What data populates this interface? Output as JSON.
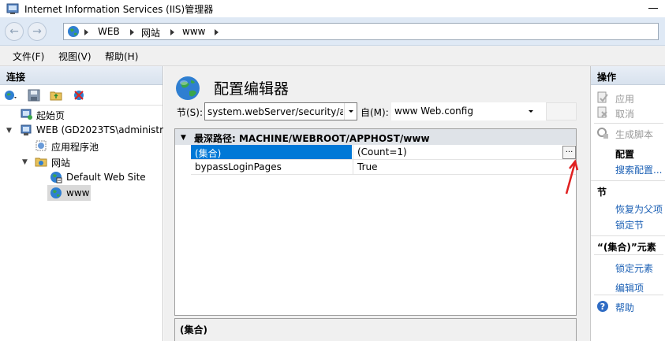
{
  "window": {
    "title": "Internet Information Services (IIS)管理器"
  },
  "address": {
    "crumbs": [
      "WEB",
      "网站",
      "www"
    ]
  },
  "menu": [
    "文件(F)",
    "视图(V)",
    "帮助(H)"
  ],
  "connections": {
    "header": "连接",
    "tree": [
      {
        "label": "起始页"
      },
      {
        "label": "WEB (GD2023TS\\administr"
      },
      {
        "label": "应用程序池"
      },
      {
        "label": "网站"
      },
      {
        "label": "Default Web Site"
      },
      {
        "label": "www"
      }
    ]
  },
  "editor": {
    "title": "配置编辑器",
    "section_label": "节(S):",
    "section_value": "system.webServer/security/au",
    "from_label": "自(M):",
    "from_value": "www Web.config",
    "group_header": "最深路径: MACHINE/WEBROOT/APPHOST/www",
    "rows": [
      {
        "key": "(集合)",
        "value": "(Count=1)"
      },
      {
        "key": "bypassLoginPages",
        "value": "True"
      }
    ],
    "ellipsis": "...",
    "details_label": "(集合)"
  },
  "actions": {
    "header": "操作",
    "apply": "应用",
    "cancel": "取消",
    "generate_script": "生成脚本",
    "config_title": "配置",
    "search_config": "搜索配置...",
    "section_header": "节",
    "restore_parent": "恢复为父项",
    "lock_section": "锁定节",
    "element_header": "“(集合)”元素",
    "lock_element": "锁定元素",
    "edit_items": "编辑项",
    "help": "帮助"
  }
}
